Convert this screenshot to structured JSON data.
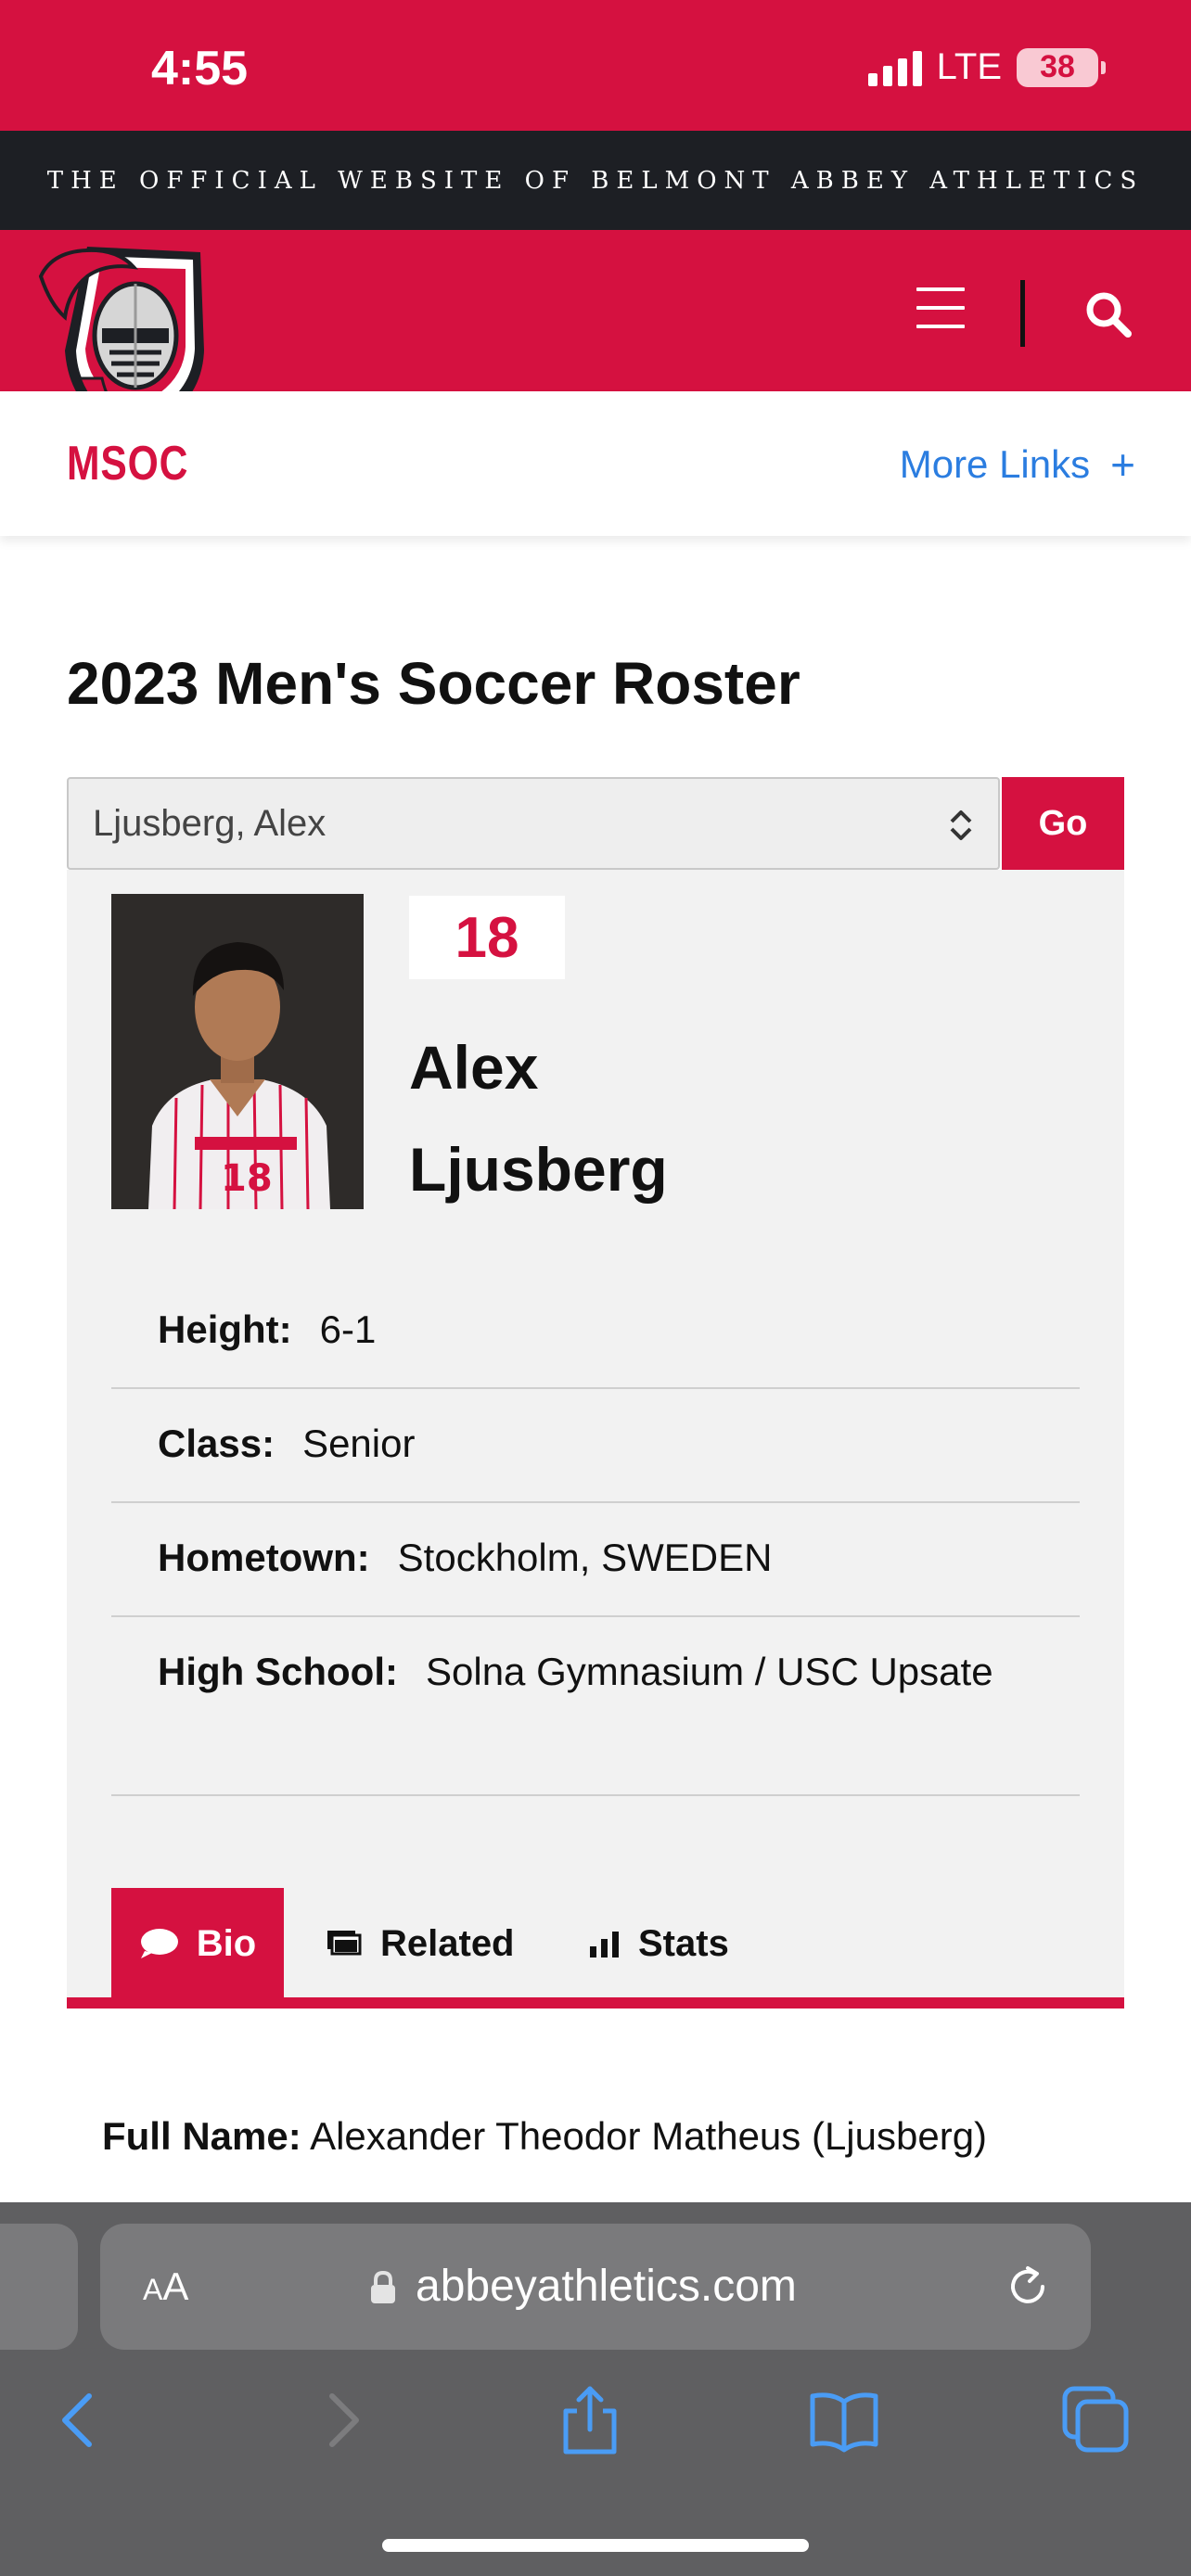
{
  "status_bar": {
    "time": "4:55",
    "network": "LTE",
    "battery": "38"
  },
  "site": {
    "official_banner": "THE OFFICIAL WEBSITE OF BELMONT ABBEY ATHLETICS",
    "sport_label": "MSOC",
    "more_links_label": "More Links",
    "brand_color": "#d51140",
    "link_color": "#2b7de0"
  },
  "roster": {
    "title": "2023 Men's Soccer Roster",
    "selected_player": "Ljusberg, Alex",
    "go_label": "Go"
  },
  "player": {
    "number": "18",
    "first_name": "Alex",
    "last_name": "Ljusberg",
    "info": {
      "height_label": "Height:",
      "height_value": "6-1",
      "class_label": "Class:",
      "class_value": "Senior",
      "hometown_label": "Hometown:",
      "hometown_value": "Stockholm, SWEDEN",
      "school_label": "High School:",
      "school_value": "Solna Gymnasium / USC Upsate"
    }
  },
  "tabs": [
    {
      "label": "Bio",
      "icon": "speech-bubble-icon",
      "active": true
    },
    {
      "label": "Related",
      "icon": "related-cards-icon",
      "active": false
    },
    {
      "label": "Stats",
      "icon": "bar-chart-icon",
      "active": false
    }
  ],
  "bio": {
    "full_name_label": "Full Name:",
    "full_name_value": "Alexander Theodor Matheus (Ljusberg)"
  },
  "browser": {
    "aa_label_small": "A",
    "aa_label_big": "A",
    "url": "abbeyathletics.com"
  }
}
